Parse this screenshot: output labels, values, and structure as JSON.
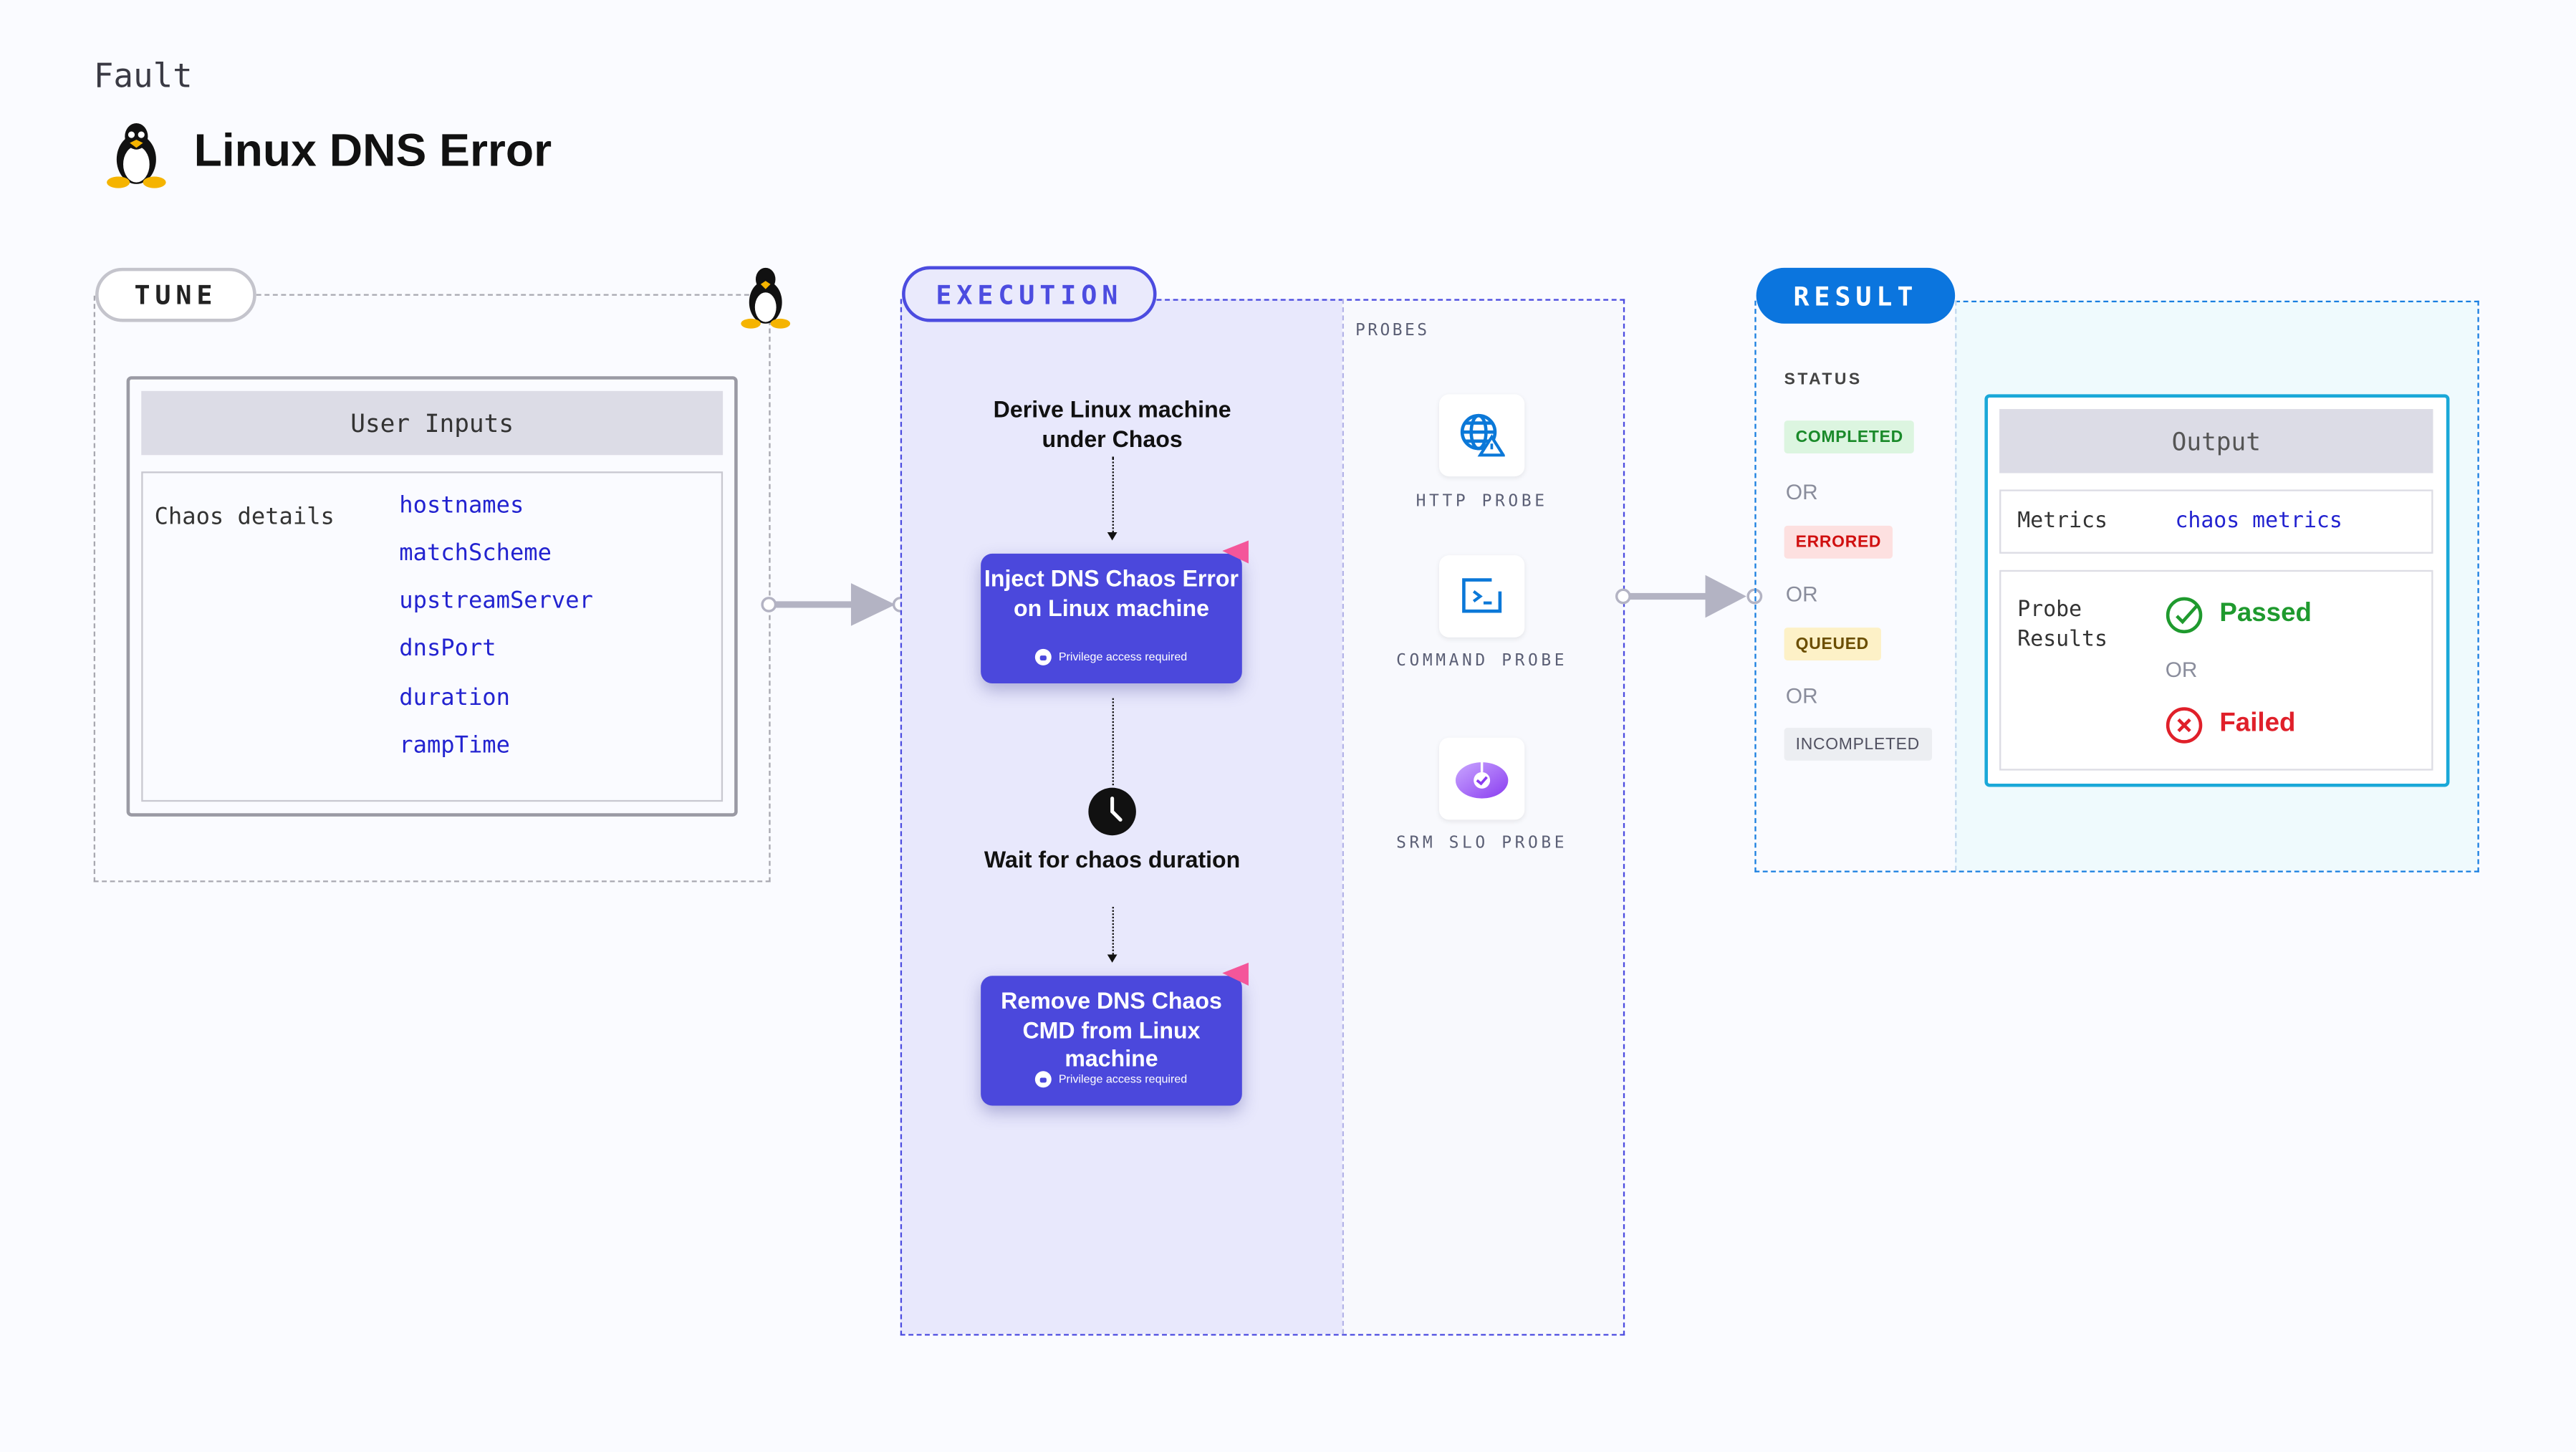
{
  "header": {
    "category": "Fault",
    "title": "Linux DNS Error",
    "icon": "linux-penguin-icon"
  },
  "tune": {
    "label": "TUNE",
    "user_inputs": {
      "title": "User Inputs",
      "section": "Chaos details",
      "params": [
        "hostnames",
        "matchScheme",
        "upstreamServer",
        "dnsPort",
        "duration",
        "rampTime"
      ]
    }
  },
  "execution": {
    "label": "EXECUTION",
    "steps": {
      "derive": "Derive Linux machine under Chaos",
      "inject": "Inject DNS Chaos Error on Linux machine",
      "wait": "Wait for chaos duration",
      "remove": "Remove DNS Chaos CMD from Linux machine",
      "privilege": "Privilege access required"
    },
    "probes": {
      "title": "PROBES",
      "items": [
        {
          "label": "HTTP PROBE",
          "icon": "globe-warning-icon"
        },
        {
          "label": "COMMAND PROBE",
          "icon": "terminal-icon"
        },
        {
          "label": "SRM SLO PROBE",
          "icon": "slo-icon"
        }
      ]
    }
  },
  "result": {
    "label": "RESULT",
    "status_title": "STATUS",
    "or": "OR",
    "statuses": [
      {
        "label": "COMPLETED",
        "color": "#1a8a2a",
        "bg": "#dcf5e0"
      },
      {
        "label": "ERRORED",
        "color": "#d01010",
        "bg": "#fde0e0"
      },
      {
        "label": "QUEUED",
        "color": "#6b4e00",
        "bg": "#fdf1c7"
      },
      {
        "label": "INCOMPLETED",
        "color": "#505060",
        "bg": "#eceef2"
      }
    ],
    "output": {
      "title": "Output",
      "metrics_label": "Metrics",
      "metrics_value": "chaos metrics",
      "probe_results_label": "Probe Results",
      "passed": "Passed",
      "failed": "Failed"
    }
  },
  "colors": {
    "execution": "#4b48dc",
    "result": "#0b75de",
    "passed": "#1f9a2e",
    "failed": "#e0202a"
  }
}
